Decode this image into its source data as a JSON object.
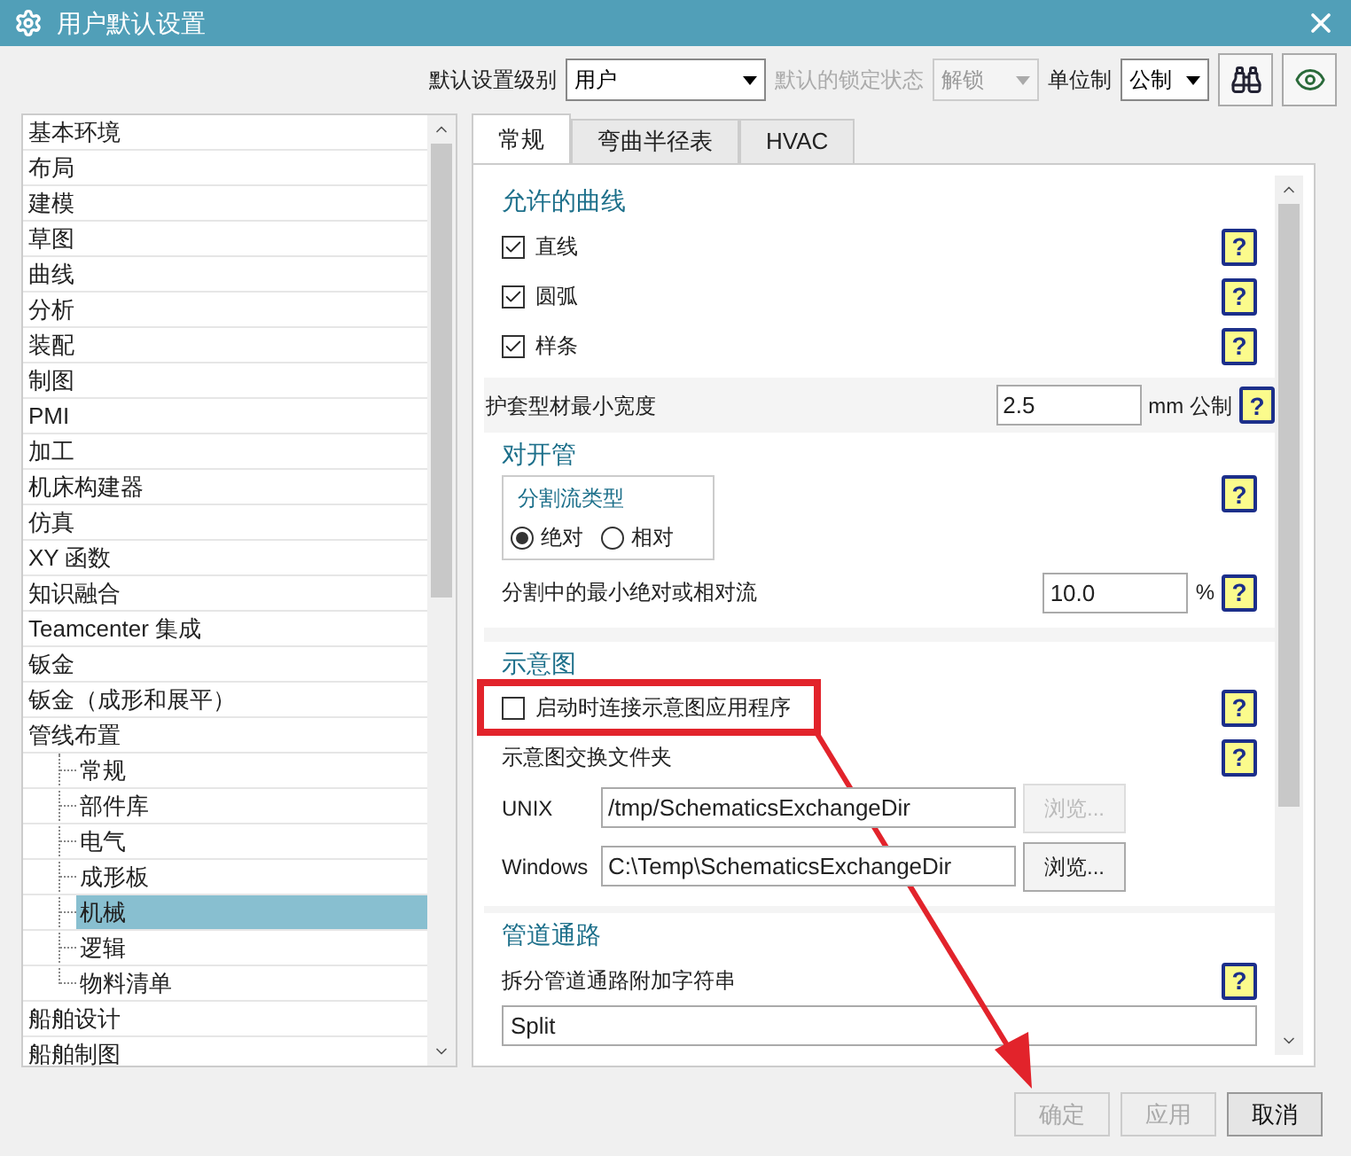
{
  "window": {
    "title": "用户默认设置"
  },
  "toolbar": {
    "level_label": "默认设置级别",
    "level_value": "用户",
    "lock_label": "默认的锁定状态",
    "lock_value": "解锁",
    "lock_disabled": true,
    "unit_label": "单位制",
    "unit_value": "公制"
  },
  "categories": [
    {
      "label": "基本环境",
      "selected": false
    },
    {
      "label": "布局",
      "selected": false
    },
    {
      "label": "建模",
      "selected": false
    },
    {
      "label": "草图",
      "selected": false
    },
    {
      "label": "曲线",
      "selected": false
    },
    {
      "label": "分析",
      "selected": false
    },
    {
      "label": "装配",
      "selected": false
    },
    {
      "label": "制图",
      "selected": false
    },
    {
      "label": "PMI",
      "selected": false
    },
    {
      "label": "加工",
      "selected": false
    },
    {
      "label": "机床构建器",
      "selected": false
    },
    {
      "label": "仿真",
      "selected": false
    },
    {
      "label": "XY 函数",
      "selected": false
    },
    {
      "label": "知识融合",
      "selected": false
    },
    {
      "label": "Teamcenter 集成",
      "selected": false
    },
    {
      "label": "钣金",
      "selected": false
    },
    {
      "label": "钣金（成形和展平）",
      "selected": false
    },
    {
      "label": "管线布置",
      "selected": false,
      "children": [
        {
          "label": "常规",
          "selected": false
        },
        {
          "label": "部件库",
          "selected": false
        },
        {
          "label": "电气",
          "selected": false
        },
        {
          "label": "成形板",
          "selected": false
        },
        {
          "label": "机械",
          "selected": true
        },
        {
          "label": "逻辑",
          "selected": false
        },
        {
          "label": "物料清单",
          "selected": false
        }
      ]
    },
    {
      "label": "船舶设计",
      "selected": false
    },
    {
      "label": "船舶制图",
      "selected": false
    }
  ],
  "tabs": [
    {
      "label": "常规",
      "selected": true
    },
    {
      "label": "弯曲半径表",
      "selected": false
    },
    {
      "label": "HVAC",
      "selected": false
    }
  ],
  "allowed_curves": {
    "title": "允许的曲线",
    "items": [
      {
        "label": "直线",
        "checked": true,
        "help": "?"
      },
      {
        "label": "圆弧",
        "checked": true,
        "help": "?"
      },
      {
        "label": "样条",
        "checked": true,
        "help": "?"
      }
    ]
  },
  "sheath_width": {
    "label": "护套型材最小宽度",
    "value": "2.5",
    "unit": "mm 公制",
    "help": "?"
  },
  "split_tee": {
    "title": "对开管",
    "group_title": "分割流类型",
    "help": "?",
    "options": [
      {
        "label": "绝对",
        "selected": true
      },
      {
        "label": "相对",
        "selected": false
      }
    ],
    "min_flow": {
      "label": "分割中的最小绝对或相对流",
      "value": "10.0",
      "unit": "%",
      "help": "?"
    }
  },
  "schematic": {
    "title": "示意图",
    "connect": {
      "label": "启动时连接示意图应用程序",
      "checked": false,
      "help": "?"
    },
    "folder_label": "示意图交换文件夹",
    "folder_help": "?",
    "paths": [
      {
        "label": "UNIX",
        "value": "/tmp/SchematicsExchangeDir",
        "browse": "浏览...",
        "disabled": true
      },
      {
        "label": "Windows",
        "value": "C:\\Temp\\SchematicsExchangeDir",
        "browse": "浏览...",
        "disabled": false
      }
    ]
  },
  "routing": {
    "title": "管道通路",
    "label": "拆分管道通路附加字符串",
    "help": "?",
    "value": "Split"
  },
  "buttons": [
    {
      "label": "确定",
      "disabled": true
    },
    {
      "label": "应用",
      "disabled": true
    },
    {
      "label": "取消",
      "disabled": false
    }
  ]
}
